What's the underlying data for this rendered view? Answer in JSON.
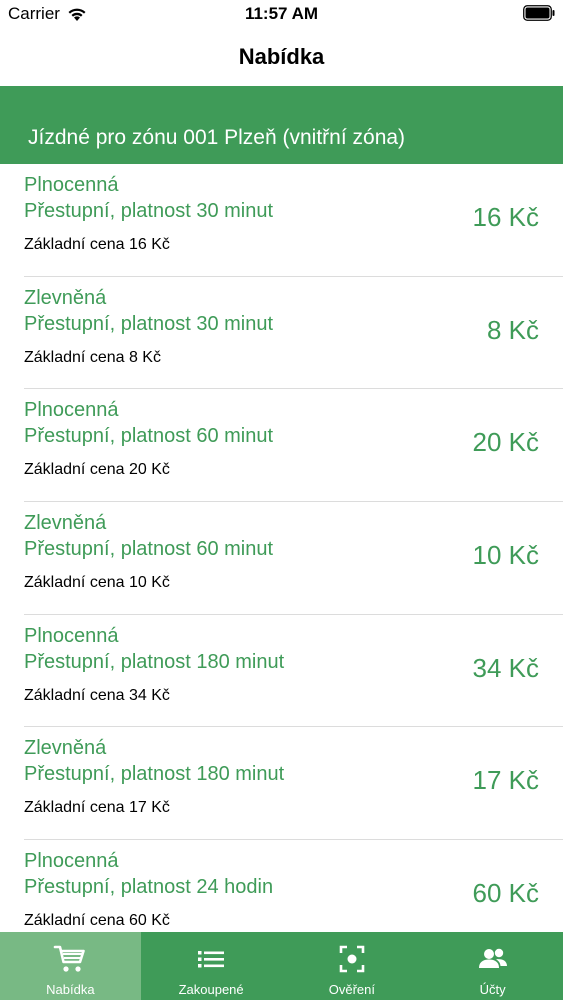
{
  "status_bar": {
    "carrier": "Carrier",
    "time": "11:57 AM"
  },
  "nav": {
    "title": "Nabídka"
  },
  "section": {
    "title": "Jízdné pro zónu 001 Plzeň (vnitřní zóna)"
  },
  "tickets": [
    {
      "type": "Plnocenná",
      "description": "Přestupní, platnost 30 minut",
      "base_price": "Základní cena 16 Kč",
      "price": "16 Kč"
    },
    {
      "type": "Zlevněná",
      "description": "Přestupní, platnost 30 minut",
      "base_price": "Základní cena 8 Kč",
      "price": "8 Kč"
    },
    {
      "type": "Plnocenná",
      "description": "Přestupní, platnost 60 minut",
      "base_price": "Základní cena 20 Kč",
      "price": "20 Kč"
    },
    {
      "type": "Zlevněná",
      "description": "Přestupní, platnost 60 minut",
      "base_price": "Základní cena 10 Kč",
      "price": "10 Kč"
    },
    {
      "type": "Plnocenná",
      "description": "Přestupní, platnost 180 minut",
      "base_price": "Základní cena 34 Kč",
      "price": "34 Kč"
    },
    {
      "type": "Zlevněná",
      "description": "Přestupní, platnost 180 minut",
      "base_price": "Základní cena 17 Kč",
      "price": "17 Kč"
    },
    {
      "type": "Plnocenná",
      "description": "Přestupní, platnost 24 hodin",
      "base_price": "Základní cena 60 Kč",
      "price": "60 Kč"
    }
  ],
  "tabs": [
    {
      "label": "Nabídka",
      "icon": "cart-icon",
      "active": true
    },
    {
      "label": "Zakoupené",
      "icon": "list-icon",
      "active": false
    },
    {
      "label": "Ověření",
      "icon": "scan-icon",
      "active": false
    },
    {
      "label": "Účty",
      "icon": "users-icon",
      "active": false
    }
  ],
  "colors": {
    "brand_green": "#3f9b58",
    "active_tab": "#78b984"
  }
}
